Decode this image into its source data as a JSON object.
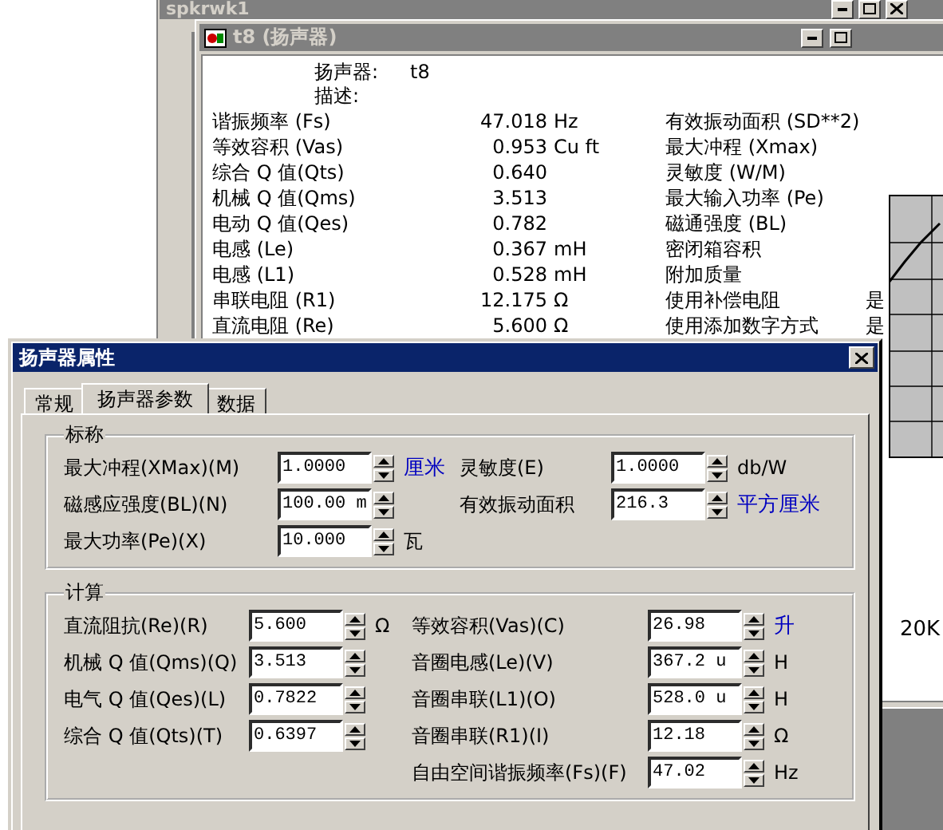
{
  "outer_window": {
    "title": "spkrwk1"
  },
  "speaker_window": {
    "title": "t8 (扬声器)",
    "header": [
      {
        "label": "扬声器:",
        "value": "t8"
      },
      {
        "label": "描述:"
      }
    ],
    "rows": [
      {
        "label": "谐振频率 (Fs)",
        "value": "47.018",
        "unit": "Hz",
        "right_label": "有效振动面积 (SD**2)"
      },
      {
        "label": "等效容积 (Vas)",
        "value": "0.953",
        "unit": "Cu ft",
        "right_label": "最大冲程 (Xmax)"
      },
      {
        "label": "综合 Q 值(Qts)",
        "value": "0.640",
        "right_label": "灵敏度 (W/M)"
      },
      {
        "label": "机械 Q 值(Qms)",
        "value": "3.513",
        "right_label": "最大输入功率 (Pe)"
      },
      {
        "label": "电动 Q 值(Qes)",
        "value": "0.782",
        "right_label": "磁通强度 (BL)"
      },
      {
        "label": "电感 (Le)",
        "value": "0.367",
        "unit": "mH",
        "right_label": "密闭箱容积"
      },
      {
        "label": "电感 (L1)",
        "value": "0.528",
        "unit": "mH",
        "right_label": "附加质量"
      },
      {
        "label": "串联电阻 (R1)",
        "value": "12.175",
        "unit": "Ω",
        "right_label": "使用补偿电阻",
        "right_value": "是"
      },
      {
        "label": "直流电阻 (Re)",
        "value": "5.600",
        "unit": "Ω",
        "right_label": "使用添加数字方式",
        "right_value": "是"
      }
    ]
  },
  "graph": {
    "axis_label": "20K"
  },
  "dialog": {
    "title": "扬声器属性",
    "tabs": [
      {
        "label": "常规",
        "selected": false
      },
      {
        "label": "扬声器参数",
        "selected": true
      },
      {
        "label": "数据",
        "selected": false
      }
    ],
    "groups": [
      {
        "title": "标称",
        "columns": [
          [
            {
              "label": "最大冲程(XMax)(M)",
              "value": "1.0000",
              "unit": "厘米",
              "highlighted": true
            },
            {
              "label": "磁感应强度(BL)(N)",
              "value": "100.00 m"
            },
            {
              "label": "最大功率(Pe)(X)",
              "value": "10.000",
              "unit": "瓦",
              "highlighted": false
            }
          ],
          [
            {
              "label": "灵敏度(E)",
              "value": "1.0000",
              "unit": "db/W",
              "highlighted": false
            },
            {
              "label": "有效振动面积",
              "value": "216.3",
              "unit": "平方厘米",
              "highlighted": true
            }
          ]
        ]
      },
      {
        "title": "计算",
        "columns": [
          [
            {
              "label": "直流阻抗(Re)(R)",
              "value": "5.600",
              "unit": "Ω",
              "highlighted": false
            },
            {
              "label": "机械 Q 值(Qms)(Q)",
              "value": "3.513"
            },
            {
              "label": "电气 Q 值(Qes)(L)",
              "value": "0.7822"
            },
            {
              "label": "综合 Q 值(Qts)(T)",
              "value": "0.6397"
            }
          ],
          [
            {
              "label": "等效容积(Vas)(C)",
              "value": "26.98",
              "unit": "升",
              "highlighted": true
            },
            {
              "label": "音圈电感(Le)(V)",
              "value": "367.2 u",
              "unit": "H",
              "highlighted": false
            },
            {
              "label": "音圈串联(L1)(O)",
              "value": "528.0 u",
              "unit": "H",
              "highlighted": false
            },
            {
              "label": "音圈串联(R1)(I)",
              "value": "12.18",
              "unit": "Ω",
              "highlighted": false
            },
            {
              "label": "自由空间谐振频率(Fs)(F)",
              "value": "47.02",
              "unit": "Hz",
              "highlighted": false
            }
          ]
        ]
      }
    ]
  }
}
